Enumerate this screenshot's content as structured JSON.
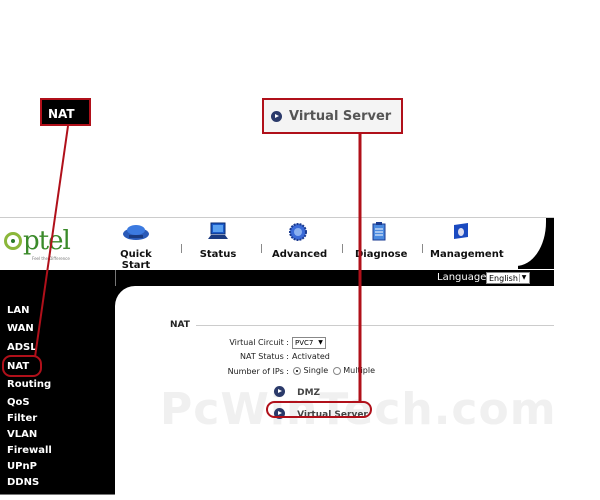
{
  "callouts": {
    "nat_label": "NAT",
    "virtual_server_label": "Virtual Server"
  },
  "logo": {
    "text": "ptel",
    "tagline": "Feel the Difference"
  },
  "nav": [
    {
      "label": "Quick Start",
      "icon": "quick-start-icon"
    },
    {
      "label": "Status",
      "icon": "status-icon"
    },
    {
      "label": "Advanced",
      "icon": "advanced-icon"
    },
    {
      "label": "Diagnose",
      "icon": "diagnose-icon"
    },
    {
      "label": "Management",
      "icon": "management-icon"
    }
  ],
  "language": {
    "label": "Language",
    "selected": "English"
  },
  "sidebar": {
    "items": [
      {
        "label": "LAN"
      },
      {
        "label": "WAN"
      },
      {
        "label": "ADSL"
      },
      {
        "label": "NAT",
        "active": true
      },
      {
        "label": "Routing"
      },
      {
        "label": "QoS"
      },
      {
        "label": "Filter"
      },
      {
        "label": "VLAN"
      },
      {
        "label": "Firewall"
      },
      {
        "label": "UPnP"
      },
      {
        "label": "DDNS"
      }
    ]
  },
  "main": {
    "section_title": "NAT",
    "virtual_circuit": {
      "label": "Virtual Circuit :",
      "value": "PVC7"
    },
    "nat_status": {
      "label": "NAT Status :",
      "value": "Activated"
    },
    "number_of_ips": {
      "label": "Number of IPs :",
      "options": [
        "Single",
        "Multiple"
      ],
      "selected": "Single"
    },
    "links": [
      {
        "label": "DMZ"
      },
      {
        "label": "Virtual Server"
      }
    ]
  },
  "watermark": "PcWinTech.com",
  "colors": {
    "annotation": "#b0101a",
    "sidebar_bg": "#000000",
    "logo_green": "#3a8a2a"
  }
}
